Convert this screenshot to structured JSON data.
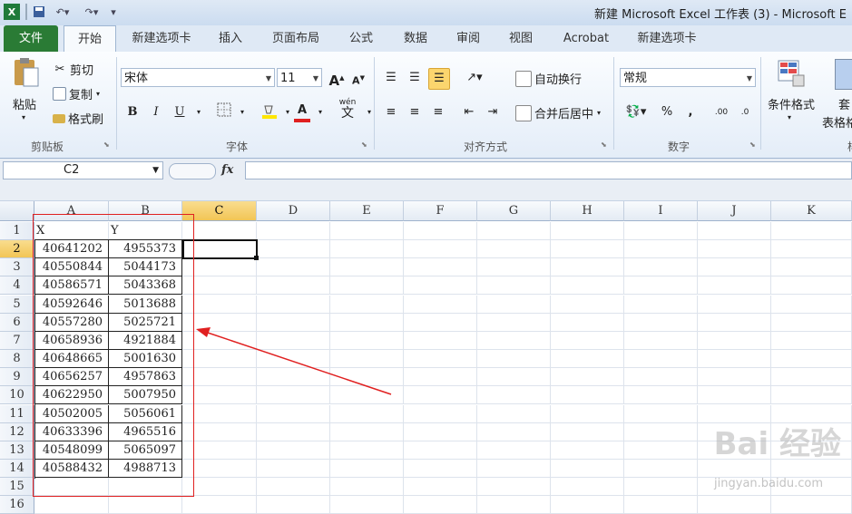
{
  "window": {
    "title": "新建 Microsoft Excel 工作表 (3) - Microsoft E"
  },
  "ribbon_tabs": [
    "文件",
    "开始",
    "新建选项卡",
    "插入",
    "页面布局",
    "公式",
    "数据",
    "审阅",
    "视图",
    "Acrobat",
    "新建选项卡"
  ],
  "clipboard": {
    "paste": "粘贴",
    "cut": "剪切",
    "copy": "复制",
    "format_painter": "格式刷",
    "group": "剪贴板"
  },
  "font": {
    "name": "宋体",
    "size": "11",
    "grow": "A",
    "shrink": "A",
    "bold": "B",
    "italic": "I",
    "underline": "U",
    "color_a": "A",
    "phonetic": "wén",
    "group": "字体"
  },
  "alignment": {
    "wrap_text": "自动换行",
    "merge_center": "合并后居中",
    "group": "对齐方式"
  },
  "number": {
    "format": "常规",
    "percent": "%",
    "comma": ",",
    "group": "数字"
  },
  "styles": {
    "conditional_format": "条件格式",
    "table_format_1": "套",
    "table_format_2": "表格格",
    "group_partial": "样"
  },
  "formula_bar": {
    "name_box": "C2",
    "fx": "fx",
    "formula": ""
  },
  "sheet": {
    "columns": [
      "A",
      "B",
      "C",
      "D",
      "E",
      "F",
      "G",
      "H",
      "I",
      "J",
      "K"
    ],
    "rows": [
      "1",
      "2",
      "3",
      "4",
      "5",
      "6",
      "7",
      "8",
      "9",
      "10",
      "11",
      "12",
      "13",
      "14",
      "15",
      "16"
    ],
    "header": [
      "X",
      "Y"
    ],
    "data": [
      [
        "40641202",
        "4955373"
      ],
      [
        "40550844",
        "5044173"
      ],
      [
        "40586571",
        "5043368"
      ],
      [
        "40592646",
        "5013688"
      ],
      [
        "40557280",
        "5025721"
      ],
      [
        "40658936",
        "4921884"
      ],
      [
        "40648665",
        "5001630"
      ],
      [
        "40656257",
        "4957863"
      ],
      [
        "40622950",
        "5007950"
      ],
      [
        "40502005",
        "5056061"
      ],
      [
        "40633396",
        "4965516"
      ],
      [
        "40548099",
        "5065097"
      ],
      [
        "40588432",
        "4988713"
      ]
    ],
    "active_column": "C",
    "active_row": "2"
  },
  "watermark": {
    "main": "Bai 经验",
    "sub": "jingyan.baidu.com"
  },
  "colors": {
    "file_tab": "#2a7b35",
    "annotation": "#e02020",
    "selected_header": "#f2c555"
  }
}
